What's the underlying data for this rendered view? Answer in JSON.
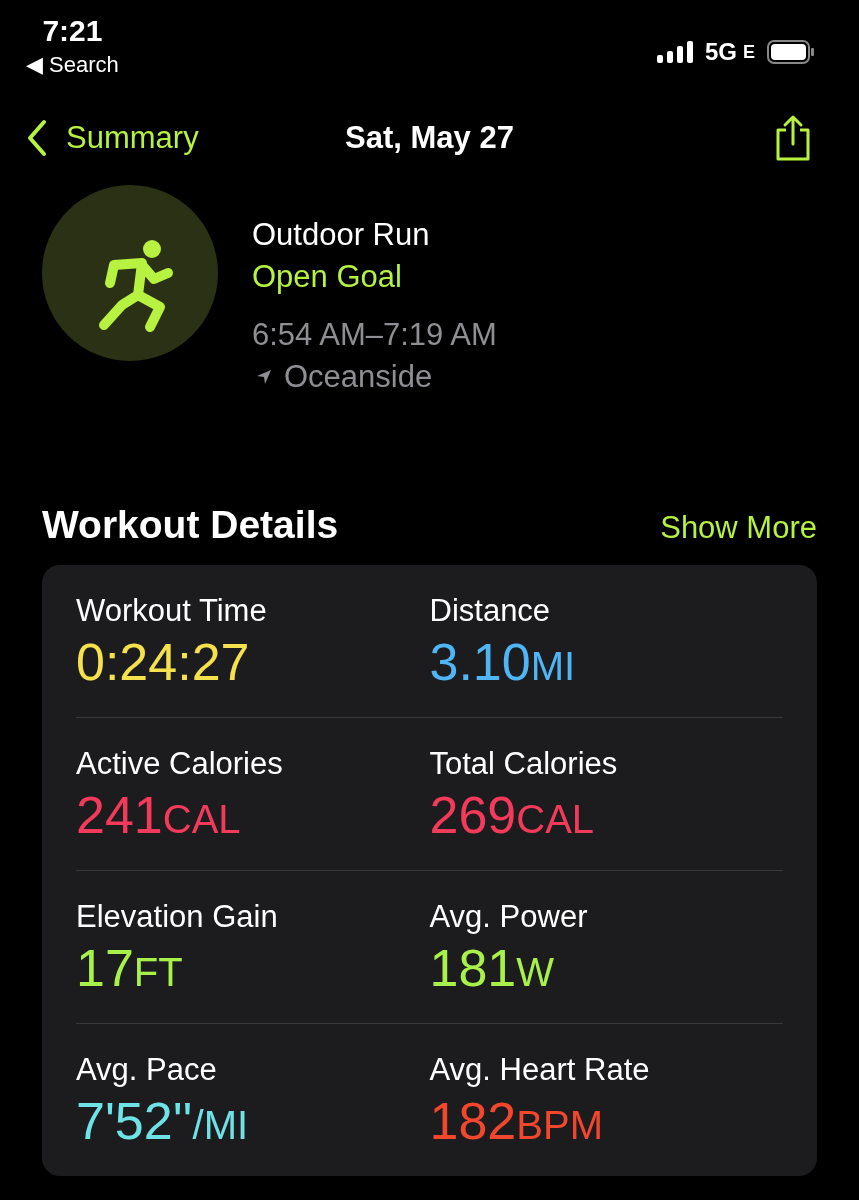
{
  "status_bar": {
    "time": "7:21",
    "back_app": "◀ Search",
    "network": "5G",
    "network_suffix": "E"
  },
  "nav": {
    "back": "Summary",
    "title": "Sat, May 27"
  },
  "workout": {
    "type": "Outdoor Run",
    "goal": "Open Goal",
    "time_range": "6:54 AM–7:19 AM",
    "location": "Oceanside"
  },
  "details": {
    "title": "Workout Details",
    "action": "Show More",
    "metrics": [
      {
        "label": "Workout Time",
        "value": "0:24:27",
        "color": "#f5e14c"
      },
      {
        "label": "Distance",
        "value": "3.10",
        "unit": "MI",
        "color": "#4fb5f5"
      },
      {
        "label": "Active Calories",
        "value": "241",
        "unit": "CAL",
        "color": "#f43a5a"
      },
      {
        "label": "Total Calories",
        "value": "269",
        "unit": "CAL",
        "color": "#f43a5a"
      },
      {
        "label": "Elevation Gain",
        "value": "17",
        "unit": "FT",
        "color": "#a8f04a"
      },
      {
        "label": "Avg. Power",
        "value": "181",
        "unit": "W",
        "color": "#a8f04a"
      },
      {
        "label": "Avg. Pace",
        "value": "7'52''",
        "unit": "/MI",
        "color": "#6ee2e6"
      },
      {
        "label": "Avg. Heart Rate",
        "value": "182",
        "unit": "BPM",
        "color": "#f2462d"
      }
    ]
  }
}
